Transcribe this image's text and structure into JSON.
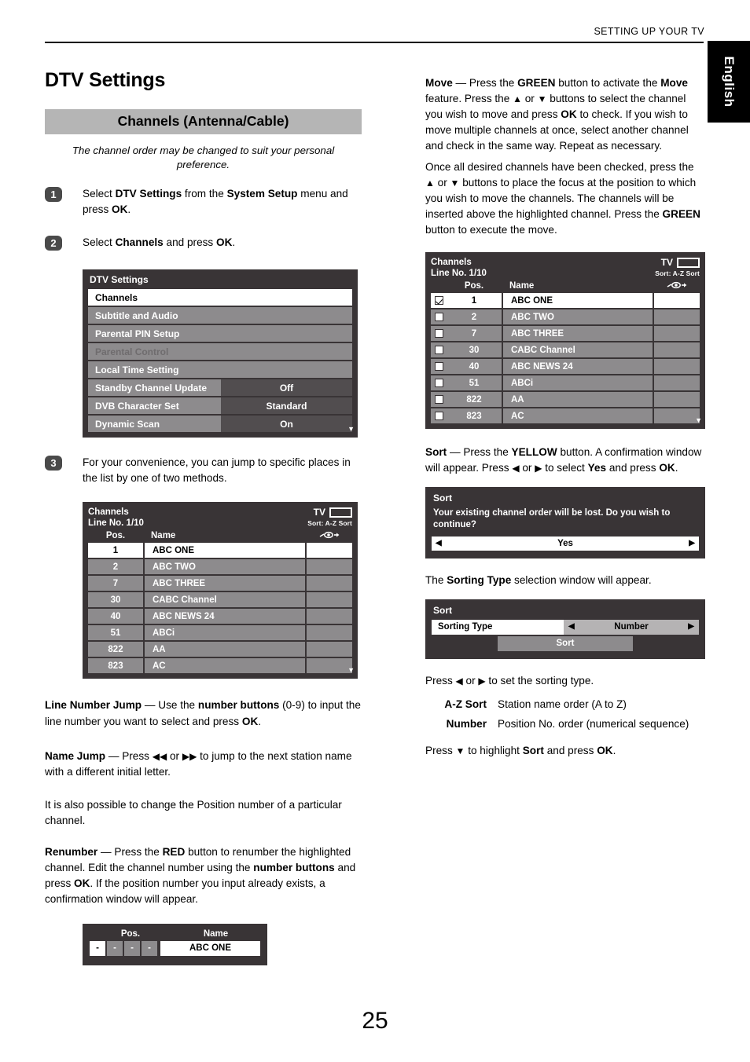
{
  "header": {
    "running_head": "SETTING UP YOUR TV",
    "language_tab": "English"
  },
  "page_number": "25",
  "left_column": {
    "title": "DTV Settings",
    "section_band": "Channels (Antenna/Cable)",
    "section_sub": "The channel order may be changed to suit your personal preference.",
    "steps": [
      {
        "num": "1",
        "html": "Select <b>DTV Settings</b> from the <b>System Setup</b> menu and press <b>OK</b>."
      },
      {
        "num": "2",
        "html": "Select <b>Channels</b> and press <b>OK</b>."
      },
      {
        "num": "3",
        "html": "For your convenience, you can jump to specific places in the list by one of two methods."
      }
    ],
    "dtv_menu": {
      "title": "DTV Settings",
      "rows": [
        {
          "label": "Channels",
          "value": "",
          "state": "selected"
        },
        {
          "label": "Subtitle and Audio",
          "value": "",
          "state": "normal"
        },
        {
          "label": "Parental PIN Setup",
          "value": "",
          "state": "normal"
        },
        {
          "label": "Parental Control",
          "value": "",
          "state": "disabled"
        },
        {
          "label": "Local Time Setting",
          "value": "",
          "state": "normal"
        },
        {
          "label": "Standby Channel Update",
          "value": "Off",
          "state": "normal"
        },
        {
          "label": "DVB Character Set",
          "value": "Standard",
          "state": "normal"
        },
        {
          "label": "Dynamic Scan",
          "value": "On",
          "state": "normal"
        }
      ],
      "scroll_caret": "▼"
    },
    "channels_osd": {
      "title": "Channels",
      "line_no": "Line No. 1/10",
      "tv_label": "TV",
      "sort_label": "Sort: A-Z Sort",
      "col_pos": "Pos.",
      "col_name": "Name",
      "scroll_caret": "▼",
      "rows": [
        {
          "pos": "1",
          "name": "ABC ONE",
          "highlight": true
        },
        {
          "pos": "2",
          "name": "ABC TWO",
          "highlight": false
        },
        {
          "pos": "7",
          "name": "ABC THREE",
          "highlight": false
        },
        {
          "pos": "30",
          "name": "CABC Channel",
          "highlight": false
        },
        {
          "pos": "40",
          "name": "ABC NEWS 24",
          "highlight": false
        },
        {
          "pos": "51",
          "name": "ABCi",
          "highlight": false
        },
        {
          "pos": "822",
          "name": "AA",
          "highlight": false
        },
        {
          "pos": "823",
          "name": "AC",
          "highlight": false
        }
      ]
    },
    "paragraphs": [
      {
        "html": "<b>Line Number Jump</b> — Use the <b>number buttons</b> (0-9) to input the line number you want to select and press <b>OK</b>."
      },
      {
        "html": "<b>Name Jump</b> — Press <span class=\"glyph\">◀◀</span> or <span class=\"glyph\">▶▶</span> to jump to the next station name with a different initial letter."
      },
      {
        "html": "It is also possible to change the Position number of a particular channel."
      },
      {
        "html": "<b>Renumber</b> — Press the <b>RED</b> button to renumber the highlighted channel. Edit the channel number using the <b>number buttons</b> and press <b>OK</b>. If the position number you input already exists, a confirmation window will appear."
      }
    ],
    "renumber_osd": {
      "col_pos": "Pos.",
      "col_name": "Name",
      "digits": [
        "-",
        "-",
        "-",
        "-"
      ],
      "name_value": "ABC ONE"
    }
  },
  "right_column": {
    "move_paragraphs": [
      {
        "html": "<b>Move</b> — Press the <b>GREEN</b> button to activate the <b>Move</b> feature. Press the <span class=\"glyph\">▲</span> or <span class=\"glyph\">▼</span> buttons to select the channel you wish to move and press <b>OK</b> to check. If you wish to move multiple channels at once, select another channel and check in the same way. Repeat as necessary."
      },
      {
        "html": "Once all desired channels have been checked, press the <span class=\"glyph\">▲</span> or <span class=\"glyph\">▼</span> buttons to place the focus at the position to which you wish to move the channels. The channels will be inserted above the highlighted channel. Press the <b>GREEN</b> button to execute the move."
      }
    ],
    "channels_osd": {
      "title": "Channels",
      "line_no": "Line No. 1/10",
      "tv_label": "TV",
      "sort_label": "Sort: A-Z Sort",
      "col_pos": "Pos.",
      "col_name": "Name",
      "scroll_caret": "▼",
      "rows": [
        {
          "pos": "1",
          "name": "ABC ONE",
          "checked": true,
          "highlight": true
        },
        {
          "pos": "2",
          "name": "ABC TWO",
          "checked": false,
          "highlight": false
        },
        {
          "pos": "7",
          "name": "ABC THREE",
          "checked": false,
          "highlight": false
        },
        {
          "pos": "30",
          "name": "CABC Channel",
          "checked": false,
          "highlight": false
        },
        {
          "pos": "40",
          "name": "ABC NEWS 24",
          "checked": false,
          "highlight": false
        },
        {
          "pos": "51",
          "name": "ABCi",
          "checked": false,
          "highlight": false
        },
        {
          "pos": "822",
          "name": "AA",
          "checked": false,
          "highlight": false
        },
        {
          "pos": "823",
          "name": "AC",
          "checked": false,
          "highlight": false
        }
      ]
    },
    "sort_paragraph": {
      "html": "<b>Sort</b> — Press the <b>YELLOW</b> button. A confirmation window will appear. Press <span class=\"glyph\">◀</span> or <span class=\"glyph\">▶</span> to select <b>Yes</b> and press <b>OK</b>."
    },
    "sort_confirm_osd": {
      "title": "Sort",
      "message": "Your existing channel order will be lost. Do you wish to continue?",
      "left_arrow": "◀",
      "choice": "Yes",
      "right_arrow": "▶"
    },
    "sorting_type_paragraph": {
      "html": "The <b>Sorting Type</b> selection window will appear."
    },
    "sorting_type_osd": {
      "title": "Sort",
      "row_label": "Sorting Type",
      "left_arrow": "◀",
      "value": "Number",
      "right_arrow": "▶",
      "sort_button": "Sort"
    },
    "after_paragraphs": [
      {
        "html": "Press <span class=\"glyph\">◀</span> or <span class=\"glyph\">▶</span> to set the sorting type."
      }
    ],
    "definitions": [
      {
        "term": "A-Z Sort",
        "desc": "Station name order (A to Z)"
      },
      {
        "term": "Number",
        "desc": "Position No. order (numerical sequence)"
      }
    ],
    "final_paragraph": {
      "html": "Press <span class=\"glyph\">▼</span> to highlight <b>Sort</b> and press <b>OK</b>."
    }
  }
}
